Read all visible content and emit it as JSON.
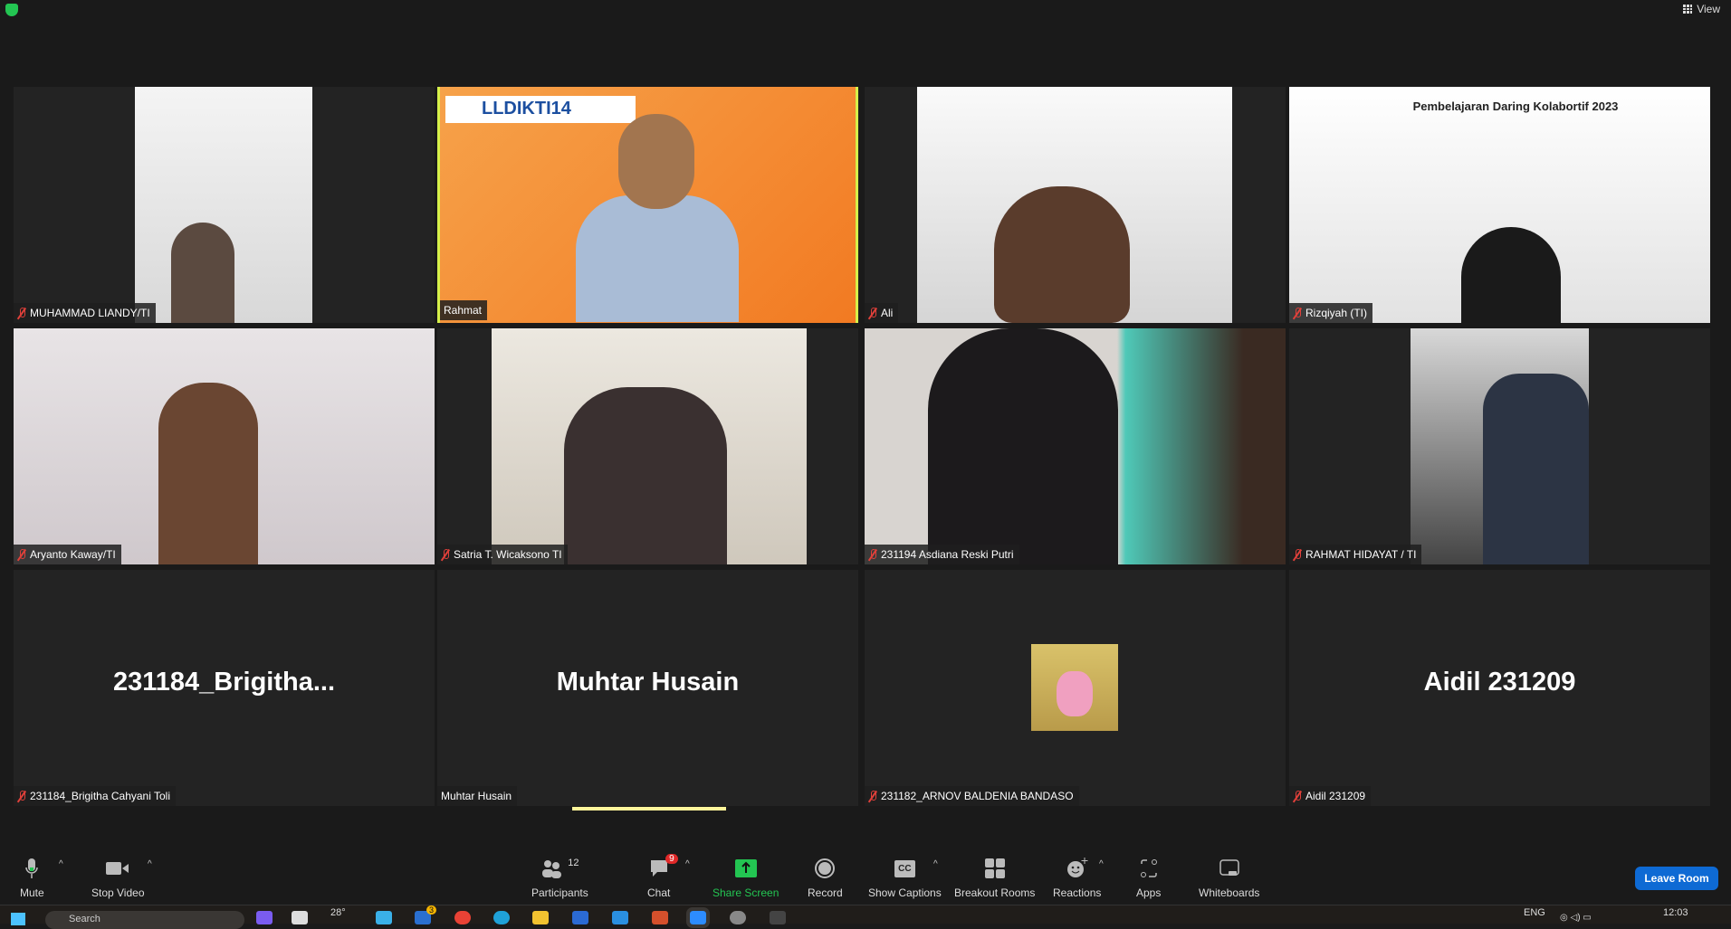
{
  "top": {
    "view_label": "View",
    "security_icon": "shield-check-icon"
  },
  "tiles": [
    {
      "name": "MUHAMMAD LIANDY/TI",
      "muted": true,
      "video": true
    },
    {
      "name": "Rahmat",
      "muted": false,
      "video": true,
      "active": true,
      "banner": "LLDIKTI14"
    },
    {
      "name": "Ali",
      "muted": true,
      "video": true
    },
    {
      "name": "Rizqiyah (TI)",
      "muted": true,
      "video": true,
      "banner": "Pembelajaran Daring Kolabortif 2023"
    },
    {
      "name": "Aryanto Kaway/TI",
      "muted": true,
      "video": true
    },
    {
      "name": "Satria T. Wicaksono TI",
      "muted": true,
      "video": true
    },
    {
      "name": "231194 Asdiana Reski Putri",
      "muted": true,
      "video": true
    },
    {
      "name": "RAHMAT HIDAYAT / TI",
      "muted": true,
      "video": true
    },
    {
      "name": "231184_Brigitha Cahyani Toli",
      "display": "231184_Brigitha...",
      "muted": true,
      "video": false
    },
    {
      "name": "Muhtar Husain",
      "display": "Muhtar Husain",
      "muted": false,
      "video": false
    },
    {
      "name": "231182_ARNOV BALDENIA BANDASO",
      "muted": true,
      "video": false,
      "avatar": true
    },
    {
      "name": "Aidil 231209",
      "display": "Aidil 231209",
      "muted": true,
      "video": false
    }
  ],
  "toolbar": {
    "mute": "Mute",
    "stop_video": "Stop Video",
    "participants": "Participants",
    "participants_count": "12",
    "chat": "Chat",
    "chat_badge": "9",
    "share_screen": "Share Screen",
    "record": "Record",
    "show_captions": "Show Captions",
    "cc": "CC",
    "breakout_rooms": "Breakout Rooms",
    "reactions": "Reactions",
    "apps": "Apps",
    "whiteboards": "Whiteboards",
    "leave": "Leave Room"
  },
  "taskbar": {
    "search": "Search",
    "weather": "28°",
    "mail_badge": "3",
    "lang": "ENG",
    "time": "12:03"
  },
  "colors": {
    "accent_share": "#23c552",
    "leave": "#0e6ad4",
    "active_speaker": "#d6f04a"
  }
}
